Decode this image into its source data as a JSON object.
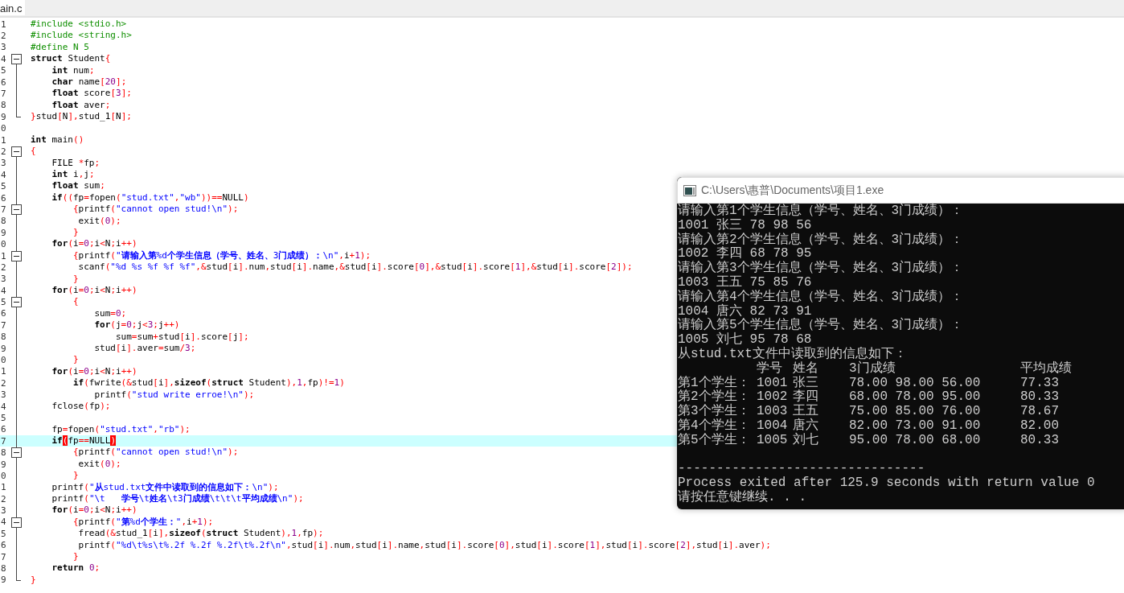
{
  "editor": {
    "tab": {
      "label": "ain.c",
      "selected": true
    },
    "lines": [
      {
        "number": "1",
        "code": "#include <stdio.h>",
        "kind": "plain",
        "current": false
      },
      {
        "number": "2",
        "code": "#include <string.h>",
        "kind": "plain",
        "current": false
      },
      {
        "number": "3",
        "code": "#define N 5",
        "kind": "plain",
        "current": false
      },
      {
        "number": "4",
        "code": "struct Student{",
        "kind": "start",
        "current": false
      },
      {
        "number": "5",
        "code": "    int num;",
        "kind": "mid",
        "current": false
      },
      {
        "number": "6",
        "code": "    char name[20];",
        "kind": "mid",
        "current": false
      },
      {
        "number": "7",
        "code": "    float score[3];",
        "kind": "mid",
        "current": false
      },
      {
        "number": "8",
        "code": "    float aver;",
        "kind": "mid",
        "current": false
      },
      {
        "number": "9",
        "code": "}stud[N],stud_1[N];",
        "kind": "end",
        "current": false
      },
      {
        "number": "0",
        "kind": "plain",
        "current": false
      },
      {
        "number": "1",
        "code": "int main()",
        "kind": "plain",
        "current": false
      },
      {
        "number": "2",
        "code": "{",
        "kind": "start",
        "current": false
      },
      {
        "number": "3",
        "code": "    FILE *fp;",
        "kind": "mid",
        "current": false
      },
      {
        "number": "4",
        "code": "    int i,j;",
        "kind": "mid",
        "current": false
      },
      {
        "number": "5",
        "code": "    float sum;",
        "kind": "mid",
        "current": false
      },
      {
        "number": "6",
        "code": "    if((fp=fopen(\"stud.txt\",\"wb\"))==NULL)",
        "kind": "mid",
        "current": false
      },
      {
        "number": "7",
        "code": "        {printf(\"cannot open stud!\\n\");",
        "kind": "nested",
        "current": false
      },
      {
        "number": "8",
        "code": "         exit(0);",
        "kind": "mid",
        "current": false
      },
      {
        "number": "9",
        "code": "        }",
        "kind": "mid",
        "current": false
      },
      {
        "number": "0",
        "code": "    for(i=0;i<N;i++)",
        "kind": "mid",
        "current": false
      },
      {
        "number": "1",
        "code": "        {printf(\"请输入第%d个学生信息（学号、姓名、3门成绩）：\\n\",i+1);",
        "kind": "nested",
        "current": false
      },
      {
        "number": "2",
        "code": "         scanf(\"%d %s %f %f %f\",&stud[i].num,stud[i].name,&stud[i].score[0],&stud[i].score[1],&stud[i].score[2]);",
        "kind": "mid",
        "current": false
      },
      {
        "number": "3",
        "code": "        }",
        "kind": "mid",
        "current": false
      },
      {
        "number": "4",
        "code": "    for(i=0;i<N;i++)",
        "kind": "mid",
        "current": false
      },
      {
        "number": "5",
        "code": "        {",
        "kind": "nested",
        "current": false
      },
      {
        "number": "6",
        "code": "            sum=0;",
        "kind": "mid",
        "current": false
      },
      {
        "number": "7",
        "code": "            for(j=0;j<3;j++)",
        "kind": "mid",
        "current": false
      },
      {
        "number": "8",
        "code": "                sum=sum+stud[i].score[j];",
        "kind": "mid",
        "current": false
      },
      {
        "number": "9",
        "code": "            stud[i].aver=sum/3;",
        "kind": "mid",
        "current": false
      },
      {
        "number": "0",
        "code": "        }",
        "kind": "mid",
        "current": false
      },
      {
        "number": "1",
        "code": "    for(i=0;i<N;i++)",
        "kind": "mid",
        "current": false
      },
      {
        "number": "2",
        "code": "        if(fwrite(&stud[i],sizeof(struct Student),1,fp)!=1)",
        "kind": "mid",
        "current": false
      },
      {
        "number": "3",
        "code": "            printf(\"stud write erroe!\\n\");",
        "kind": "mid",
        "current": false
      },
      {
        "number": "4",
        "code": "    fclose(fp);",
        "kind": "mid",
        "current": false
      },
      {
        "number": "5",
        "kind": "mid",
        "current": false
      },
      {
        "number": "6",
        "code": "    fp=fopen(\"stud.txt\",\"rb\");",
        "kind": "mid",
        "current": false
      },
      {
        "number": "7",
        "code": "    if(fp==NULL)",
        "kind": "mid",
        "current": true
      },
      {
        "number": "8",
        "code": "        {printf(\"cannot open stud!\\n\");",
        "kind": "nested",
        "current": false
      },
      {
        "number": "9",
        "code": "         exit(0);",
        "kind": "mid",
        "current": false
      },
      {
        "number": "0",
        "code": "        }",
        "kind": "mid",
        "current": false
      },
      {
        "number": "1",
        "code": "    printf(\"从stud.txt文件中读取到的信息如下：\\n\");",
        "kind": "mid",
        "current": false
      },
      {
        "number": "2",
        "code": "    printf(\"\\t   学号\\t姓名\\t3门成绩\\t\\t\\t平均成绩\\n\");",
        "kind": "mid",
        "current": false
      },
      {
        "number": "3",
        "code": "    for(i=0;i<N;i++)",
        "kind": "mid",
        "current": false
      },
      {
        "number": "4",
        "code": "        {printf(\"第%d个学生：\",i+1);",
        "kind": "nested",
        "current": false
      },
      {
        "number": "5",
        "code": "         fread(&stud_1[i],sizeof(struct Student),1,fp);",
        "kind": "mid",
        "current": false
      },
      {
        "number": "6",
        "code": "         printf(\"%d\\t%s\\t%.2f %.2f %.2f\\t%.2f\\n\",stud[i].num,stud[i].name,stud[i].score[0],stud[i].score[1],stud[i].score[2],stud[i].aver);",
        "kind": "mid",
        "current": false
      },
      {
        "number": "7",
        "code": "        }",
        "kind": "mid",
        "current": false
      },
      {
        "number": "8",
        "code": "    return 0;",
        "kind": "mid",
        "current": false
      },
      {
        "number": "9",
        "code": "}",
        "kind": "end",
        "current": false
      }
    ]
  },
  "console": {
    "title": "C:\\Users\\惠普\\Documents\\项目1.exe",
    "lines": [
      {
        "kind": "text",
        "text": "请输入第1个学生信息（学号、姓名、3门成绩）："
      },
      {
        "kind": "text",
        "text": "1001 张三 78 98 56"
      },
      {
        "kind": "text",
        "text": "请输入第2个学生信息（学号、姓名、3门成绩）："
      },
      {
        "kind": "text",
        "text": "1002 李四 68 78 95"
      },
      {
        "kind": "text",
        "text": "请输入第3个学生信息（学号、姓名、3门成绩）："
      },
      {
        "kind": "text",
        "text": "1003 王五 75 85 76"
      },
      {
        "kind": "text",
        "text": "请输入第4个学生信息（学号、姓名、3门成绩）："
      },
      {
        "kind": "text",
        "text": "1004 唐六 82 73 91"
      },
      {
        "kind": "text",
        "text": "请输入第5个学生信息（学号、姓名、3门成绩）："
      },
      {
        "kind": "text",
        "text": "1005 刘七 95 78 68"
      },
      {
        "kind": "text",
        "text": "从stud.txt文件中读取到的信息如下："
      },
      {
        "kind": "header",
        "cells": [
          "学号",
          "姓名",
          "3门成绩",
          "平均成绩"
        ]
      },
      {
        "kind": "row",
        "cells": [
          "第1个学生：",
          "1001",
          "张三",
          "78.00 98.00 56.00",
          "77.33"
        ]
      },
      {
        "kind": "row",
        "cells": [
          "第2个学生：",
          "1002",
          "李四",
          "68.00 78.00 95.00",
          "80.33"
        ]
      },
      {
        "kind": "row",
        "cells": [
          "第3个学生：",
          "1003",
          "王五",
          "75.00 85.00 76.00",
          "78.67"
        ]
      },
      {
        "kind": "row",
        "cells": [
          "第4个学生：",
          "1004",
          "唐六",
          "82.00 73.00 91.00",
          "82.00"
        ]
      },
      {
        "kind": "row",
        "cells": [
          "第5个学生：",
          "1005",
          "刘七",
          "95.00 78.00 68.00",
          "80.33"
        ]
      },
      {
        "kind": "blank"
      },
      {
        "kind": "text",
        "text": "--------------------------------"
      },
      {
        "kind": "text",
        "text": "Process exited after 125.9 seconds with return value 0"
      },
      {
        "kind": "text",
        "text": "请按任意键继续. . ."
      }
    ]
  }
}
